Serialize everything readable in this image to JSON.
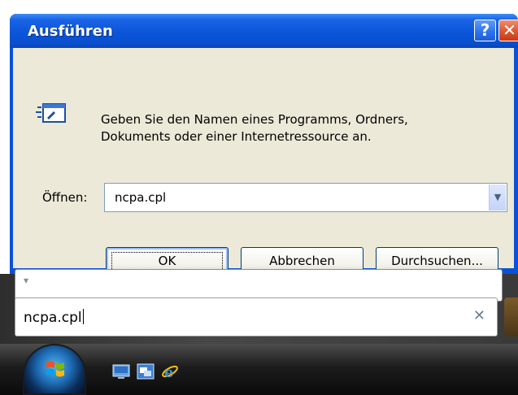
{
  "dialog": {
    "title": "Ausführen",
    "help_glyph": "?",
    "close_glyph": "✕",
    "prompt_line1": "Geben Sie den Namen eines Programms, Ordners,",
    "prompt_line2": "Dokuments oder einer Internetressource an.",
    "open_label": "Öffnen:",
    "open_value": "ncpa.cpl",
    "buttons": {
      "ok": "OK",
      "cancel": "Abbrechen",
      "browse": "Durchsuchen..."
    }
  },
  "vista": {
    "search_value": "ncpa.cpl",
    "clear_glyph": "✕"
  },
  "icons": {
    "run": "run-icon",
    "dropdown": "chevron-down-icon",
    "start": "windows-start-orb-icon",
    "show_desktop": "show-desktop-icon",
    "switch_windows": "switch-windows-icon",
    "internet_explorer": "internet-explorer-icon"
  },
  "colors": {
    "xp_title_blue": "#0a55d9",
    "xp_dialog_bg": "#ece9d8",
    "close_red": "#e05a32",
    "vista_taskbar": "#1c1c1c"
  }
}
